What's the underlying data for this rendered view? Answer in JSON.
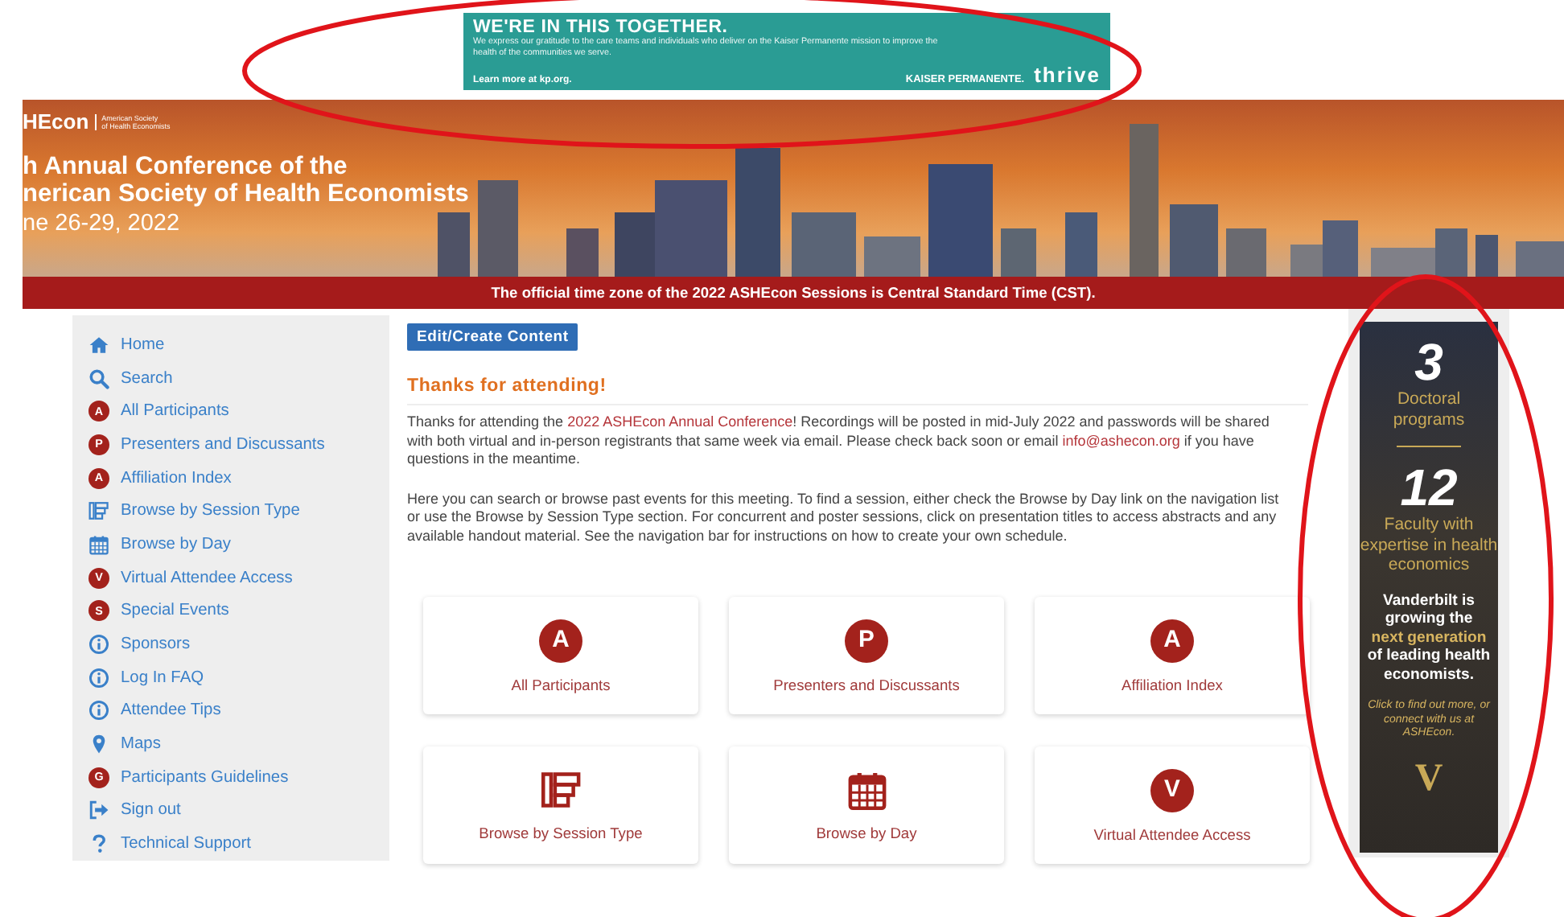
{
  "ad_banner": {
    "headline": "WE'RE IN THIS TOGETHER.",
    "body": "We express our gratitude to the care teams and individuals who deliver on the Kaiser Permanente mission to improve the health of the communities we serve.",
    "link": "Learn more at kp.org.",
    "sponsor": "KAISER PERMANENTE.",
    "brand": "thrive"
  },
  "header": {
    "logo": "HEcon",
    "logo_subtitle": [
      "American Society",
      "of Health Economists"
    ],
    "title_lines": [
      "h Annual Conference of the",
      "nerican Society of Health Economists"
    ],
    "dates": "ne 26-29, 2022",
    "notice": "The official time zone of the 2022 ASHEcon Sessions is Central Standard Time (CST)."
  },
  "sidebar": {
    "items": [
      {
        "label": "Home",
        "kind": "home"
      },
      {
        "label": "Search",
        "kind": "search"
      },
      {
        "label": "All Participants",
        "kind": "letter",
        "letter": "A"
      },
      {
        "label": "Presenters and Discussants",
        "kind": "letter",
        "letter": "P"
      },
      {
        "label": "Affiliation Index",
        "kind": "letter",
        "letter": "A"
      },
      {
        "label": "Browse by Session Type",
        "kind": "session"
      },
      {
        "label": "Browse by Day",
        "kind": "calendar"
      },
      {
        "label": "Virtual Attendee Access",
        "kind": "letter",
        "letter": "V"
      },
      {
        "label": "Special Events",
        "kind": "letter",
        "letter": "S"
      },
      {
        "label": "Sponsors",
        "kind": "info"
      },
      {
        "label": "Log In FAQ",
        "kind": "info"
      },
      {
        "label": "Attendee Tips",
        "kind": "info"
      },
      {
        "label": "Maps",
        "kind": "pin"
      },
      {
        "label": "Participants Guidelines",
        "kind": "letter",
        "letter": "G"
      },
      {
        "label": "Sign out",
        "kind": "signout"
      },
      {
        "label": "Technical Support",
        "kind": "question"
      }
    ]
  },
  "main": {
    "button": "Edit/Create Content",
    "heading": "Thanks for attending!",
    "paragraphs": [
      [
        {
          "kind": "text",
          "text": "Thanks for attending the "
        },
        {
          "kind": "link",
          "text": "2022 ASHEcon Annual Conference"
        },
        {
          "kind": "text",
          "text": "! Recordings will be posted in mid-July 2022 and passwords will be shared with both virtual and in-person registrants that same week via email. Please check back soon or email "
        },
        {
          "kind": "link",
          "text": "info@ashecon.org"
        },
        {
          "kind": "text",
          "text": " if you have questions in the meantime."
        }
      ],
      [
        {
          "kind": "text",
          "text": "Here you can search or browse past events for this meeting. To find a session, either check the Browse by Day link on the navigation list or use the Browse by Session Type section. For concurrent and poster sessions, click on presentation titles to access abstracts and any available handout material. See the navigation bar for instructions on how to create your own schedule."
        }
      ]
    ],
    "cards": [
      {
        "label": "All Participants",
        "kind": "letter",
        "letter": "A"
      },
      {
        "label": "Presenters and Discussants",
        "kind": "letter",
        "letter": "P"
      },
      {
        "label": "Affiliation Index",
        "kind": "letter",
        "letter": "A"
      },
      {
        "label": "Browse by Session Type",
        "kind": "session"
      },
      {
        "label": "Browse by Day",
        "kind": "calendar"
      },
      {
        "label": "Virtual Attendee Access",
        "kind": "letter",
        "letter": "V"
      }
    ]
  },
  "side_ad": {
    "stat_1": "3",
    "stat_1_label": "Doctoral programs",
    "stat_2": "12",
    "stat_2_label": "Faculty with expertise in health economics",
    "statement": [
      {
        "text": "Vanderbilt is growing the",
        "highlight": false
      },
      {
        "text": "next generation",
        "highlight": true
      },
      {
        "text": "of leading health economists.",
        "highlight": false
      }
    ],
    "cta": "Click to find out more, or connect with us at ASHEcon.",
    "logo": "V"
  }
}
